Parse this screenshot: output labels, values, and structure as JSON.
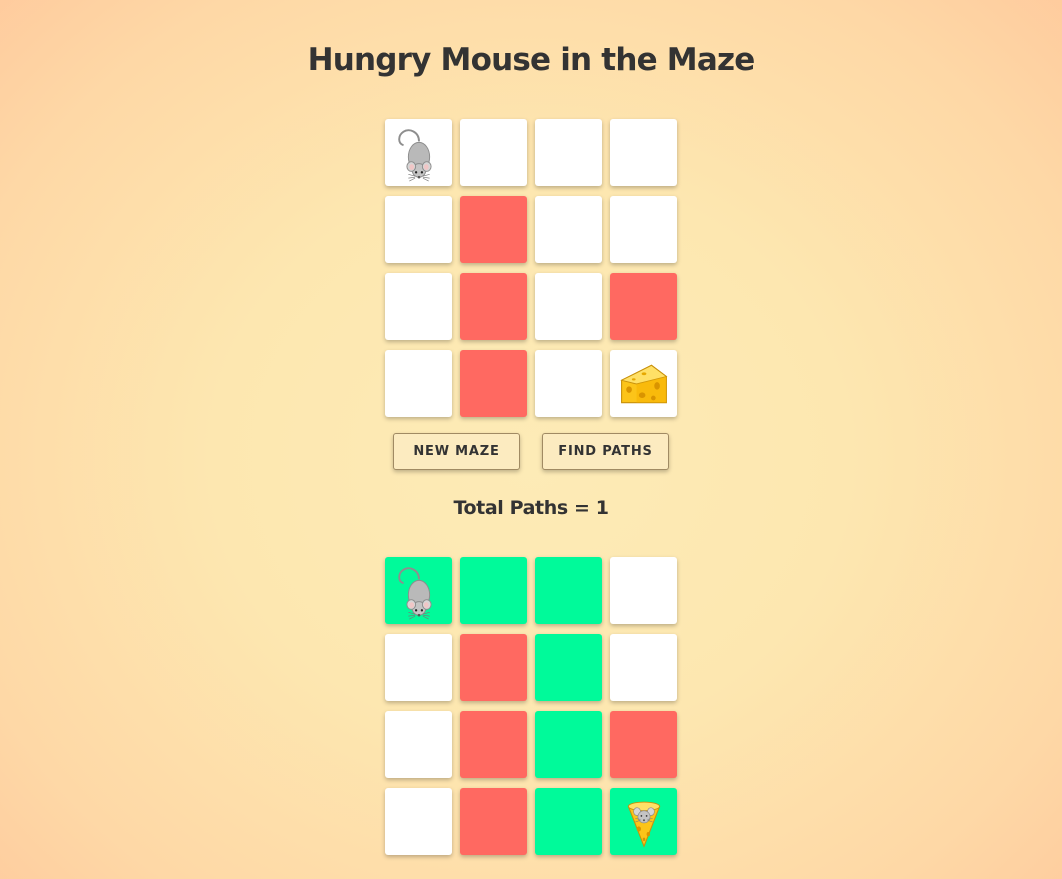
{
  "title": "Hungry Mouse in the Maze",
  "buttons": {
    "new_maze": "NEW MAZE",
    "find_paths": "FIND PATHS"
  },
  "total_paths": {
    "label": "Total Paths = 1",
    "count": 1
  },
  "colors": {
    "open": "#ffffff",
    "wall": "#ff6961",
    "path": "#00fa9a",
    "button_bg": "#fcebc0",
    "text": "#333333"
  },
  "maze": {
    "size": 4,
    "cells": [
      [
        "mouse",
        "open",
        "open",
        "open"
      ],
      [
        "open",
        "wall",
        "open",
        "open"
      ],
      [
        "open",
        "wall",
        "open",
        "wall"
      ],
      [
        "open",
        "wall",
        "open",
        "cheese"
      ]
    ]
  },
  "solution": {
    "size": 4,
    "cells": [
      [
        "path-mouse",
        "path",
        "path",
        "open"
      ],
      [
        "open",
        "wall",
        "path",
        "open"
      ],
      [
        "open",
        "wall",
        "path",
        "wall"
      ],
      [
        "open",
        "wall",
        "path",
        "path-cheese-mouse"
      ]
    ]
  },
  "icons": {
    "mouse": "mouse-icon",
    "cheese": "cheese-icon",
    "mouse_in_cheese": "mouse-in-cheese-icon"
  }
}
